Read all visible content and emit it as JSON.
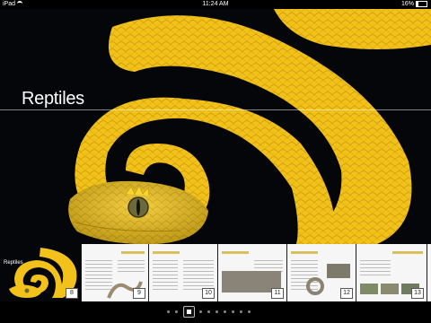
{
  "status_bar": {
    "device": "iPad",
    "time": "11:24 AM",
    "battery": "16%"
  },
  "hero": {
    "title": "Reptiles"
  },
  "thumbnails": [
    {
      "label": "Reptiles",
      "number": "8"
    },
    {
      "number": "9"
    },
    {
      "number": "10"
    },
    {
      "number": "11"
    },
    {
      "number": "12"
    },
    {
      "number": "13"
    }
  ],
  "page_indicator": {
    "current_page": 4,
    "total_pages": 10
  },
  "colors": {
    "snake_yellow": "#f2c21a",
    "background": "#05060a"
  }
}
